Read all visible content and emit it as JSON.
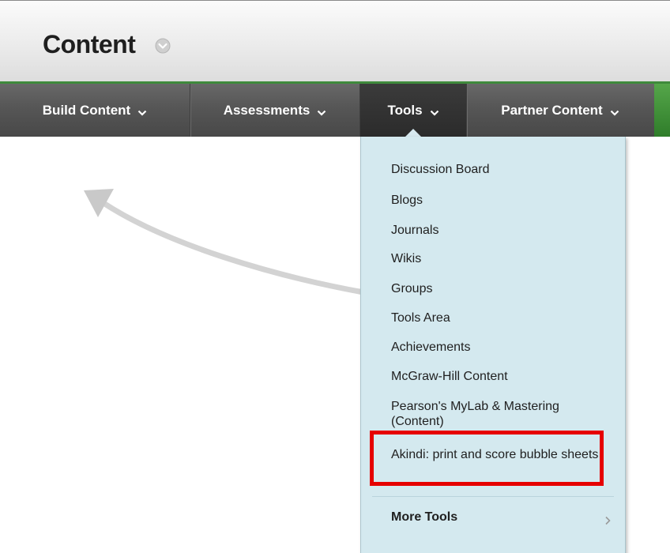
{
  "page": {
    "title": "Content",
    "title_menu_icon": "chevron-down-circle-icon"
  },
  "nav": {
    "items": [
      {
        "label": "Build Content",
        "icon": "chevron-down-icon"
      },
      {
        "label": "Assessments",
        "icon": "chevron-down-icon"
      },
      {
        "label": "Tools",
        "icon": "chevron-down-icon",
        "active": true
      },
      {
        "label": "Partner Content",
        "icon": "chevron-down-icon"
      }
    ]
  },
  "tools_menu": {
    "items": [
      {
        "label": "Discussion Board"
      },
      {
        "label": "Blogs"
      },
      {
        "label": "Journals"
      },
      {
        "label": "Wikis"
      },
      {
        "label": "Groups"
      },
      {
        "label": "Tools Area"
      },
      {
        "label": "Achievements"
      },
      {
        "label": "McGraw-Hill Content"
      },
      {
        "label": "Pearson's MyLab & Mastering (Content)"
      },
      {
        "label": "Akindi: print and score bubble sheets",
        "highlighted": true
      }
    ],
    "more_tools": {
      "label": "More Tools",
      "icon": "chevron-right-icon"
    }
  },
  "colors": {
    "nav_background": "#555555",
    "nav_active": "#2f2f2f",
    "accent_green": "#3f8a3c",
    "menu_background": "#d4e9ef",
    "highlight_red": "#e60000"
  }
}
